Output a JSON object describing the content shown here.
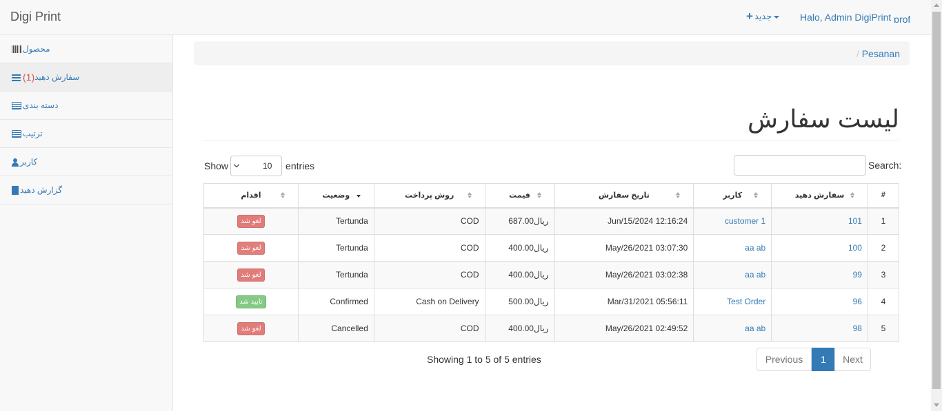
{
  "navbar": {
    "brand": "Digi Print",
    "new_label": "جدید",
    "user_label": "Halo, Admin DigiPrint",
    "user_suffix": "prof"
  },
  "sidebar": {
    "items": [
      {
        "label": "محصول",
        "icon": "barcode-icon"
      },
      {
        "label": "سفارش دهید",
        "count": "(1)",
        "icon": "bars-icon",
        "active": true
      },
      {
        "label": "دسته بندی",
        "icon": "list-alt-icon"
      },
      {
        "label": "ترتیب",
        "icon": "list-alt-icon"
      },
      {
        "label": "کاربر",
        "icon": "user-icon"
      },
      {
        "label": "گزارش دهید",
        "icon": "file-icon"
      }
    ]
  },
  "breadcrumb": {
    "separator": "/",
    "current": "Pesanan"
  },
  "page": {
    "title": "لیست سفارش"
  },
  "controls": {
    "show_label": "Show",
    "entries_label": "entries",
    "page_length": "10",
    "search_label": "Search:",
    "search_value": ""
  },
  "table": {
    "headers": {
      "num": "#",
      "order": "سفارش دهید",
      "user": "کاربر",
      "date": "تاریخ سفارش",
      "price": "قیمت",
      "payment": "روش پرداخت",
      "status": "وضعیت",
      "action": "اقدام"
    },
    "rows": [
      {
        "num": "1",
        "order": "101",
        "user": "customer 1",
        "date": "Jun/15/2024 12:16:24",
        "price": "687.00ریال",
        "payment": "COD",
        "status": "Tertunda",
        "action": "لغو شد",
        "action_color": "#d9534f"
      },
      {
        "num": "2",
        "order": "100",
        "user": "aa ab",
        "date": "May/26/2021 03:07:30",
        "price": "400.00ریال",
        "payment": "COD",
        "status": "Tertunda",
        "action": "لغو شد",
        "action_color": "#d9534f"
      },
      {
        "num": "3",
        "order": "99",
        "user": "aa ab",
        "date": "May/26/2021 03:02:38",
        "price": "400.00ریال",
        "payment": "COD",
        "status": "Tertunda",
        "action": "لغو شد",
        "action_color": "#d9534f"
      },
      {
        "num": "4",
        "order": "96",
        "user": "Test Order",
        "date": "Mar/31/2021 05:56:11",
        "price": "500.00ریال",
        "payment": "Cash on Delivery",
        "status": "Confirmed",
        "action": "تایید شد",
        "action_color": "#5cb85c"
      },
      {
        "num": "5",
        "order": "98",
        "user": "aa ab",
        "date": "May/26/2021 02:49:52",
        "price": "400.00ریال",
        "payment": "COD",
        "status": "Cancelled",
        "action": "لغو شد",
        "action_color": "#d9534f"
      }
    ]
  },
  "footer": {
    "info": "Showing 1 to 5 of 5 entries",
    "previous": "Previous",
    "current_page": "1",
    "next": "Next"
  }
}
